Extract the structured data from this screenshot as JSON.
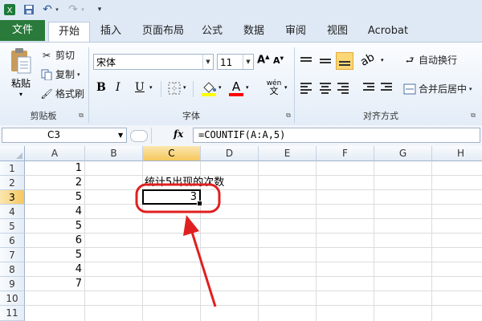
{
  "qat": {
    "icons": [
      "excel-icon",
      "save-icon",
      "undo-icon",
      "redo-icon",
      "customize-icon"
    ]
  },
  "tabs": [
    "文件",
    "开始",
    "插入",
    "页面布局",
    "公式",
    "数据",
    "审阅",
    "视图",
    "Acrobat"
  ],
  "ribbon": {
    "clipboard": {
      "paste": "粘贴",
      "cut": "剪切",
      "copy": "复制",
      "format_painter": "格式刷",
      "group": "剪贴板"
    },
    "font": {
      "name": "宋体",
      "size": "11",
      "grow": "A",
      "shrink": "A",
      "bold": "B",
      "italic": "I",
      "underline": "U",
      "font_color": "A",
      "phonetic": "wén",
      "group": "字体"
    },
    "alignment": {
      "wrap": "自动换行",
      "merge": "合并后居中",
      "group": "对齐方式"
    },
    "fill_color": "#ffff00",
    "font_color_value": "#ff0000"
  },
  "formula_bar": {
    "name_box": "C3",
    "fx": "fx",
    "formula": "=COUNTIF(A:A,5)"
  },
  "columns": [
    "A",
    "B",
    "C",
    "D",
    "E",
    "F",
    "G",
    "H"
  ],
  "rows": [
    "1",
    "2",
    "3",
    "4",
    "5",
    "6",
    "7",
    "8",
    "9",
    "10",
    "11"
  ],
  "cells": {
    "A": [
      "1",
      "2",
      "5",
      "4",
      "5",
      "6",
      "5",
      "4",
      "7"
    ],
    "C2": "统计5出现的次数",
    "C3": "3"
  },
  "selected": {
    "column": "C",
    "row": "3"
  },
  "colors": {
    "file_tab": "#2a7a3b",
    "highlight": "#e02020",
    "selection_header": "#f6c75c"
  }
}
